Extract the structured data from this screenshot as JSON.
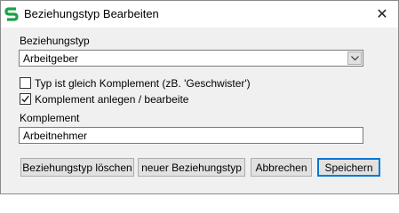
{
  "window": {
    "title": "Beziehungstyp Bearbeiten",
    "app_icon": "app-s-logo-icon",
    "close_icon": "close-icon",
    "close_glyph": "✕"
  },
  "form": {
    "relationship_type_label": "Beziehungstyp",
    "relationship_type_value": "Arbeitgeber",
    "same_as_complement_label": "Typ ist gleich Komplement (zB. 'Geschwister')",
    "same_as_complement_checked": false,
    "create_edit_complement_label": "Komplement anlegen / bearbeite",
    "create_edit_complement_checked": true,
    "complement_label": "Komplement",
    "complement_value": "Arbeitnehmer"
  },
  "buttons": {
    "delete": "Beziehungstyp löschen",
    "new": "neuer Beziehungstyp",
    "cancel": "Abbrechen",
    "save": "Speichern"
  },
  "colors": {
    "accent": "#0078d7",
    "logo_green": "#1aa14a"
  }
}
